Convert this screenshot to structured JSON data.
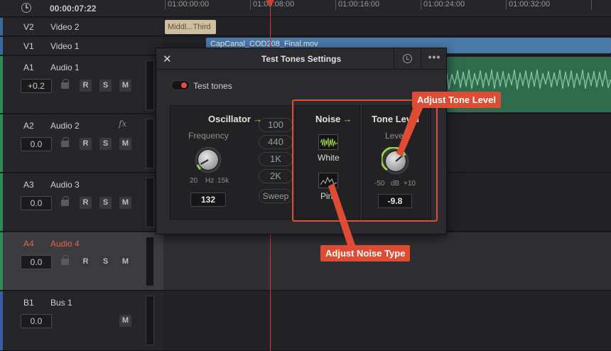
{
  "header": {
    "timecode": "00:00:07:22",
    "ruler_ticks": [
      "01:00:00:00",
      "01:00:08:00",
      "01:00:16:00",
      "01:00:24:00",
      "01:00:32:00"
    ]
  },
  "tracks": {
    "v2": {
      "id": "V2",
      "name": "Video 2"
    },
    "v1": {
      "id": "V1",
      "name": "Video 1"
    },
    "a1": {
      "id": "A1",
      "name": "Audio 1",
      "volume": "+0.2"
    },
    "a2": {
      "id": "A2",
      "name": "Audio 2",
      "volume": "0.0",
      "fx": "fx"
    },
    "a3": {
      "id": "A3",
      "name": "Audio 3",
      "volume": "0.0"
    },
    "a4": {
      "id": "A4",
      "name": "Audio 4",
      "volume": "0.0"
    },
    "b1": {
      "id": "B1",
      "name": "Bus 1",
      "volume": "0.0"
    }
  },
  "track_buttons": {
    "record": "R",
    "solo": "S",
    "mute": "M"
  },
  "clips": {
    "title_clip": "Middl...Third",
    "video_clip": "CapCanal_COD208_Final.mov"
  },
  "dialog": {
    "title": "Test Tones Settings",
    "close": "✕",
    "more": "•••",
    "test_tones_label": "Test tones",
    "oscillator": {
      "title": "Oscillator",
      "frequency_label": "Frequency",
      "range_min": "20",
      "range_unit": "Hz",
      "range_max": "15k",
      "value": "132",
      "presets": [
        "100",
        "440",
        "1K",
        "2K"
      ],
      "sweep": "Sweep"
    },
    "noise": {
      "title": "Noise",
      "white": "White",
      "pink": "Pink"
    },
    "tone_level": {
      "title": "Tone Level",
      "level_label": "Level",
      "range_min": "-50",
      "range_unit": "dB",
      "range_max": "+10",
      "value": "-9.8"
    },
    "arrow_glyph": "→"
  },
  "annotations": {
    "tone_level_callout": "Adjust Tone Level",
    "noise_type_callout": "Adjust Noise Type",
    "accent_color": "#e04b33"
  }
}
